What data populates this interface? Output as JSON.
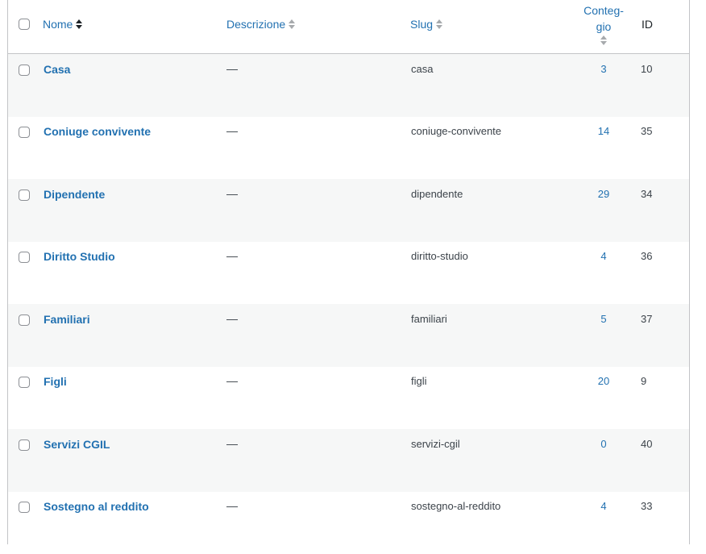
{
  "header": {
    "name_label": "Nome",
    "description_label": "Descrizione",
    "slug_label": "Slug",
    "count_label_line1": "Conteg-",
    "count_label_line2": "gio",
    "id_label": "ID"
  },
  "rows": [
    {
      "name": "Casa",
      "description": "—",
      "slug": "casa",
      "count": "3",
      "id": "10"
    },
    {
      "name": "Coniuge convivente",
      "description": "—",
      "slug": "coniuge-convivente",
      "count": "14",
      "id": "35"
    },
    {
      "name": "Dipendente",
      "description": "—",
      "slug": "dipendente",
      "count": "29",
      "id": "34"
    },
    {
      "name": "Diritto Studio",
      "description": "—",
      "slug": "diritto-studio",
      "count": "4",
      "id": "36"
    },
    {
      "name": "Familiari",
      "description": "—",
      "slug": "familiari",
      "count": "5",
      "id": "37"
    },
    {
      "name": "Figli",
      "description": "—",
      "slug": "figli",
      "count": "20",
      "id": "9"
    },
    {
      "name": "Servizi CGIL",
      "description": "—",
      "slug": "servizi-cgil",
      "count": "0",
      "id": "40"
    },
    {
      "name": "Sostegno al reddito",
      "description": "—",
      "slug": "sostegno-al-reddito",
      "count": "4",
      "id": "33"
    }
  ],
  "colors": {
    "link": "#2271b1",
    "text": "#3c434a",
    "border": "#c3c4c7",
    "alt_row": "#f6f7f7"
  }
}
